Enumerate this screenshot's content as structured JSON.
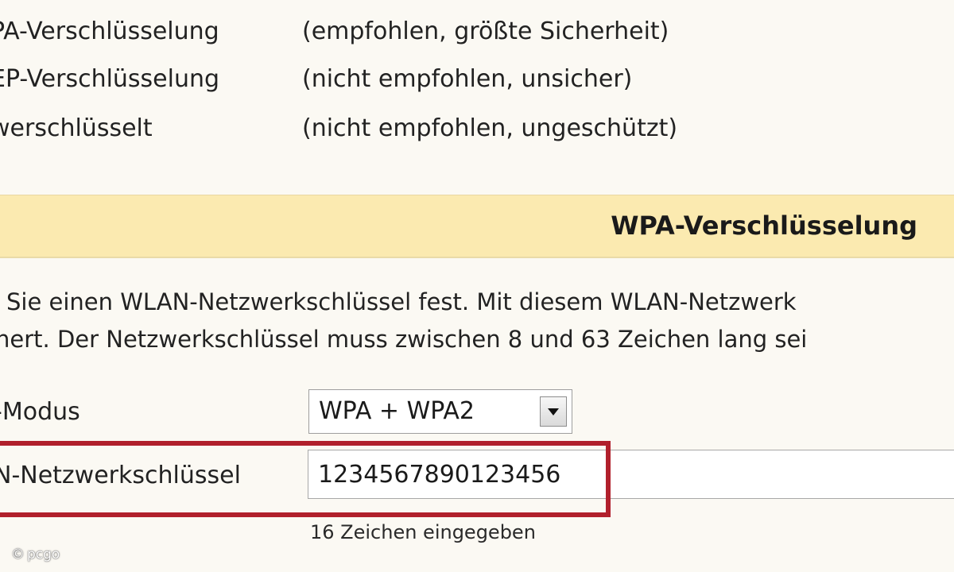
{
  "encryption_options": [
    {
      "label": "PA-Verschlüsselung",
      "description": "(empfohlen, größte Sicherheit)"
    },
    {
      "label": "EP-Verschlüsselung",
      "description": "(nicht empfohlen, unsicher)"
    },
    {
      "label": "werschlüsselt",
      "description": "(nicht empfohlen, ungeschützt)"
    }
  ],
  "section": {
    "title": "WPA-Verschlüsselung"
  },
  "description": {
    "line1": "Sie einen WLAN-Netzwerkschlüssel fest. Mit diesem WLAN-Netzwerk",
    "line2": "hert. Der Netzwerkschlüssel muss zwischen 8 und 63 Zeichen lang sei"
  },
  "mode": {
    "label": "-Modus",
    "selected": "WPA + WPA2"
  },
  "key": {
    "label": "N-Netzwerkschlüssel",
    "value": "1234567890123456",
    "counter": "16 Zeichen eingegeben"
  },
  "watermark": {
    "text": "pcgo"
  },
  "colors": {
    "background": "#fbf9f3",
    "section_bar": "#fbeab0",
    "highlight": "#b1202c"
  }
}
